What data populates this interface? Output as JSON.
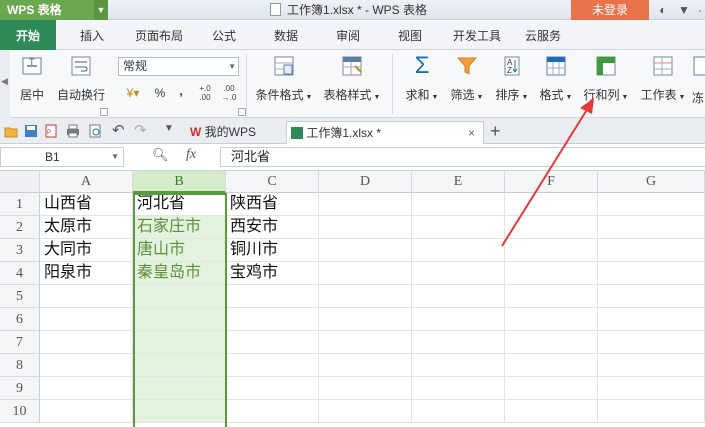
{
  "titlebar": {
    "app_name": "WPS 表格",
    "doc_title": "工作簿1.xlsx * - WPS 表格",
    "login": "未登录"
  },
  "menu": {
    "tabs": [
      "开始",
      "插入",
      "页面布局",
      "公式",
      "数据",
      "审阅",
      "视图",
      "开发工具",
      "云服务"
    ]
  },
  "ribbon": {
    "center_label": "居中",
    "wrap_label": "自动换行",
    "number_format": "常规",
    "percent": "%",
    "comma": ",",
    "cond_format": "条件格式",
    "table_style": "表格样式",
    "sum": "求和",
    "filter": "筛选",
    "sort": "排序",
    "format": "格式",
    "rowcol": "行和列",
    "worksheet": "工作表",
    "freeze_partial": "冻"
  },
  "docbar": {
    "my_wps": "我的WPS",
    "workbook_tab": "工作簿1.xlsx *",
    "new_tab": "+"
  },
  "formula": {
    "namebox": "B1",
    "fx": "fx",
    "value": "河北省"
  },
  "grid": {
    "columns": [
      "A",
      "B",
      "C",
      "D",
      "E",
      "F",
      "G"
    ],
    "rows": [
      "1",
      "2",
      "3",
      "4",
      "5",
      "6",
      "7",
      "8",
      "9",
      "10"
    ],
    "colA": [
      "山西省",
      "太原市",
      "大同市",
      "阳泉市"
    ],
    "colB": [
      "河北省",
      "石家庄市",
      "唐山市",
      "秦皇岛市"
    ],
    "colC": [
      "陕西省",
      "西安市",
      "铜川市",
      "宝鸡市"
    ],
    "selected_column": "B",
    "active_cell": "B1"
  },
  "colors": {
    "accent_green": "#2e8b57",
    "selection": "#e2f2dc",
    "selection_border": "#5a9a3c",
    "login_orange": "#e8734a",
    "annotation_red": "#e53935"
  }
}
